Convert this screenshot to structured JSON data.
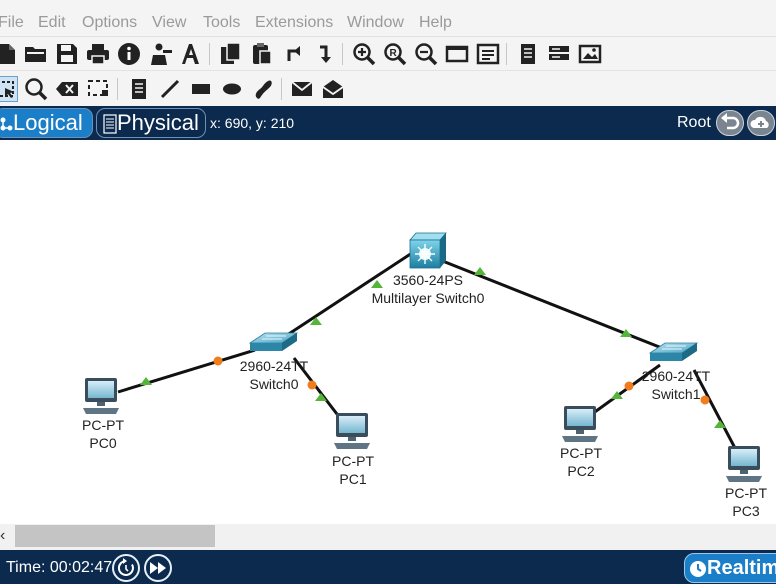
{
  "menu": [
    "File",
    "Edit",
    "Options",
    "View",
    "Tools",
    "Extensions",
    "Window",
    "Help"
  ],
  "toolbar_main": [
    "new-file-icon",
    "open-folder-icon",
    "save-icon",
    "print-icon",
    "info-icon",
    "activity-wizard-icon",
    "font-icon",
    "copy-icon",
    "paste-icon",
    "undo-icon",
    "redo-icon",
    "zoom-in-icon",
    "zoom-reset-icon",
    "zoom-out-icon",
    "drawing-palette-icon",
    "custom-device-dialog-icon",
    "viewport-icon",
    "network-info-icon",
    "screenshot-icon"
  ],
  "toolbar_tools": [
    "select-icon",
    "inspect-icon",
    "delete-icon",
    "resize-shape-icon",
    "note-icon",
    "line-icon",
    "rectangle-icon",
    "ellipse-icon",
    "freeform-icon",
    "simple-pdu-icon",
    "complex-pdu-icon"
  ],
  "modebar": {
    "logical_label": "Logical",
    "physical_label": "Physical",
    "coords": "x: 690, y: 210",
    "root_label": "Root"
  },
  "devices": [
    {
      "id": "multilayer-switch0",
      "type": "multilayer-switch",
      "model": "3560-24PS",
      "name": "Multilayer Switch0"
    },
    {
      "id": "switch0",
      "type": "switch",
      "model": "2960-24TT",
      "name": "Switch0"
    },
    {
      "id": "switch1",
      "type": "switch",
      "model": "2960-24TT",
      "name": "Switch1"
    },
    {
      "id": "pc0",
      "type": "pc",
      "model": "PC-PT",
      "name": "PC0"
    },
    {
      "id": "pc1",
      "type": "pc",
      "model": "PC-PT",
      "name": "PC1"
    },
    {
      "id": "pc2",
      "type": "pc",
      "model": "PC-PT",
      "name": "PC2"
    },
    {
      "id": "pc3",
      "type": "pc",
      "model": "PC-PT",
      "name": "PC3"
    }
  ],
  "links": [
    {
      "from": "multilayer-switch0",
      "to": "switch0",
      "status": "up"
    },
    {
      "from": "multilayer-switch0",
      "to": "switch1",
      "status": "up"
    },
    {
      "from": "switch0",
      "to": "pc0",
      "status": "orange / up"
    },
    {
      "from": "switch0",
      "to": "pc1",
      "status": "orange / up"
    },
    {
      "from": "switch1",
      "to": "pc2",
      "status": "orange / up"
    },
    {
      "from": "switch1",
      "to": "pc3",
      "status": "orange / up"
    }
  ],
  "status": {
    "time": "Time: 00:02:47",
    "realtime_label": "Realtime"
  },
  "colors": {
    "header_bg": "#0b2a4e",
    "accent": "#1a7fc8",
    "link_up": "#55b43a",
    "link_pending": "#f07c1c"
  }
}
